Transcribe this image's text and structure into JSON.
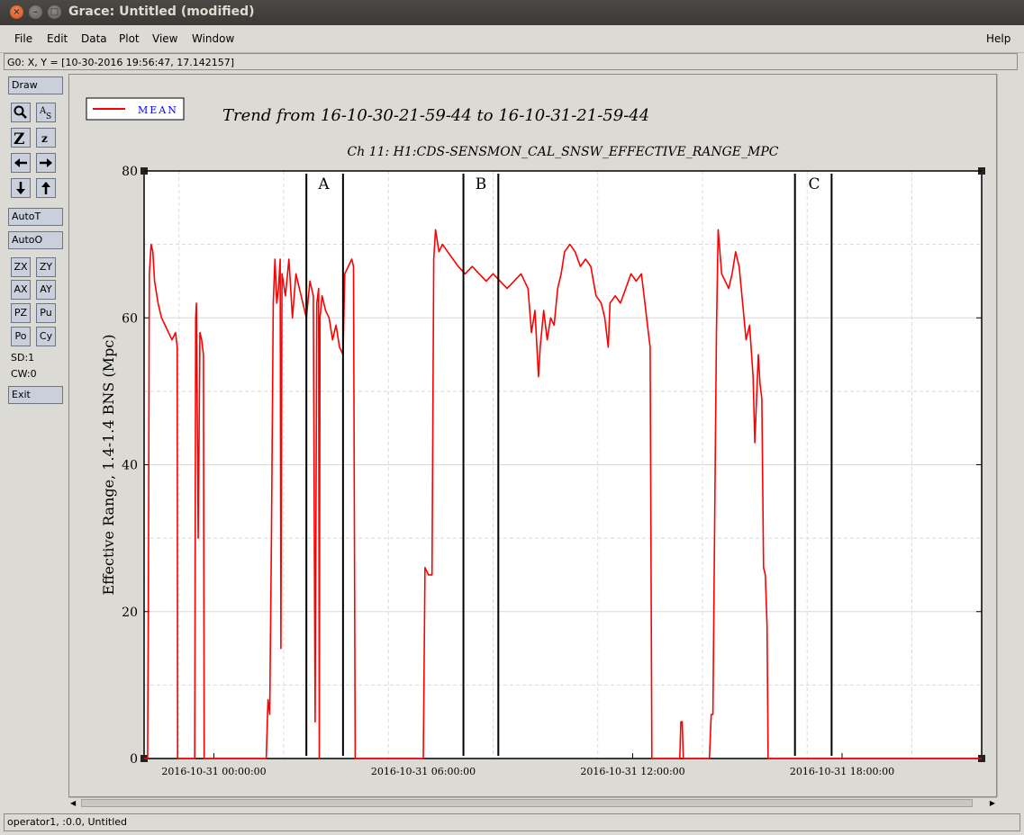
{
  "window": {
    "title": "Grace: Untitled (modified)"
  },
  "menu": {
    "file": "File",
    "edit": "Edit",
    "data": "Data",
    "plot": "Plot",
    "view": "View",
    "window": "Window",
    "help": "Help"
  },
  "locator": "G0: X, Y = [10-30-2016 19:56:47, 17.142157]",
  "toolbar": {
    "draw": "Draw",
    "autot": "AutoT",
    "autoo": "AutoO",
    "zx": "ZX",
    "zy": "ZY",
    "ax": "AX",
    "ay": "AY",
    "pz": "PZ",
    "pu": "Pu",
    "po": "Po",
    "cy": "Cy",
    "sd": "SD:1",
    "cw": "CW:0",
    "exit": "Exit"
  },
  "status": "operator1, :0.0, Untitled",
  "colors": {
    "series": "#ff0000",
    "markers": "#000000",
    "legend_text": "#0000ff"
  },
  "chart_data": {
    "type": "line",
    "title": "Trend from 16-10-30-21-59-44 to 16-10-31-21-59-44",
    "subtitle": "Ch 11: H1:CDS-SENSMON_CAL_SNSW_EFFECTIVE_RANGE_MPC",
    "ylabel": "Effective Range, 1.4-1.4 BNS (Mpc)",
    "xlabel": "",
    "xlim": [
      -2.0,
      22.0
    ],
    "ylim": [
      0,
      80
    ],
    "yticks": [
      0,
      20,
      40,
      60,
      80
    ],
    "xticks": [
      {
        "x": 0,
        "label": "2016-10-31 00:00:00"
      },
      {
        "x": 6,
        "label": "2016-10-31 06:00:00"
      },
      {
        "x": 12,
        "label": "2016-10-31 12:00:00"
      },
      {
        "x": 18,
        "label": "2016-10-31 18:00:00"
      }
    ],
    "x_units": "hours relative to 2016-10-31 00:00:00",
    "grid": true,
    "legend": {
      "position": "top-left",
      "entries": [
        "MEAN"
      ]
    },
    "series": [
      {
        "name": "MEAN",
        "points": [
          [
            -2.0,
            0
          ],
          [
            -1.9,
            0
          ],
          [
            -1.88,
            20
          ],
          [
            -1.85,
            66
          ],
          [
            -1.8,
            70
          ],
          [
            -1.75,
            69
          ],
          [
            -1.7,
            65
          ],
          [
            -1.6,
            62
          ],
          [
            -1.5,
            60
          ],
          [
            -1.4,
            59
          ],
          [
            -1.3,
            58
          ],
          [
            -1.2,
            57
          ],
          [
            -1.1,
            58
          ],
          [
            -1.05,
            56
          ],
          [
            -1.04,
            0
          ],
          [
            -0.55,
            0
          ],
          [
            -0.54,
            22
          ],
          [
            -0.52,
            60
          ],
          [
            -0.5,
            62
          ],
          [
            -0.45,
            30
          ],
          [
            -0.4,
            58
          ],
          [
            -0.35,
            57
          ],
          [
            -0.3,
            55
          ],
          [
            -0.28,
            0
          ],
          [
            1.5,
            0
          ],
          [
            1.55,
            8
          ],
          [
            1.6,
            6
          ],
          [
            1.65,
            30
          ],
          [
            1.7,
            62
          ],
          [
            1.75,
            68
          ],
          [
            1.8,
            62
          ],
          [
            1.85,
            64
          ],
          [
            1.9,
            68
          ],
          [
            1.92,
            15
          ],
          [
            1.95,
            66
          ],
          [
            2.05,
            63
          ],
          [
            2.15,
            68
          ],
          [
            2.25,
            60
          ],
          [
            2.35,
            66
          ],
          [
            2.45,
            64
          ],
          [
            2.55,
            62
          ],
          [
            2.65,
            60
          ],
          [
            2.75,
            65
          ],
          [
            2.85,
            63
          ],
          [
            2.9,
            5
          ],
          [
            2.95,
            62
          ],
          [
            3.0,
            64
          ],
          [
            3.02,
            0
          ],
          [
            3.04,
            60
          ],
          [
            3.1,
            63
          ],
          [
            3.2,
            61
          ],
          [
            3.3,
            60
          ],
          [
            3.4,
            57
          ],
          [
            3.5,
            59
          ],
          [
            3.6,
            56
          ],
          [
            3.7,
            55
          ],
          [
            3.75,
            66
          ],
          [
            3.85,
            67
          ],
          [
            3.95,
            68
          ],
          [
            4.0,
            67
          ],
          [
            4.05,
            0
          ],
          [
            6.0,
            0
          ],
          [
            6.05,
            26
          ],
          [
            6.15,
            25
          ],
          [
            6.25,
            25
          ],
          [
            6.3,
            68
          ],
          [
            6.35,
            72
          ],
          [
            6.45,
            69
          ],
          [
            6.55,
            70
          ],
          [
            6.7,
            69
          ],
          [
            6.85,
            68
          ],
          [
            7.0,
            67
          ],
          [
            7.2,
            66
          ],
          [
            7.4,
            67
          ],
          [
            7.6,
            66
          ],
          [
            7.8,
            65
          ],
          [
            8.0,
            66
          ],
          [
            8.2,
            65
          ],
          [
            8.4,
            64
          ],
          [
            8.6,
            65
          ],
          [
            8.8,
            66
          ],
          [
            9.0,
            64
          ],
          [
            9.1,
            58
          ],
          [
            9.2,
            61
          ],
          [
            9.3,
            52
          ],
          [
            9.35,
            56
          ],
          [
            9.45,
            61
          ],
          [
            9.55,
            57
          ],
          [
            9.65,
            60
          ],
          [
            9.75,
            59
          ],
          [
            9.85,
            64
          ],
          [
            9.95,
            66
          ],
          [
            10.05,
            69
          ],
          [
            10.2,
            70
          ],
          [
            10.35,
            69
          ],
          [
            10.5,
            67
          ],
          [
            10.65,
            68
          ],
          [
            10.8,
            67
          ],
          [
            10.95,
            63
          ],
          [
            11.1,
            62
          ],
          [
            11.2,
            60
          ],
          [
            11.3,
            56
          ],
          [
            11.35,
            62
          ],
          [
            11.5,
            63
          ],
          [
            11.65,
            62
          ],
          [
            11.8,
            64
          ],
          [
            11.95,
            66
          ],
          [
            12.1,
            65
          ],
          [
            12.25,
            66
          ],
          [
            12.35,
            62
          ],
          [
            12.45,
            58
          ],
          [
            12.5,
            56
          ],
          [
            12.55,
            0
          ],
          [
            13.35,
            0
          ],
          [
            13.38,
            5
          ],
          [
            13.42,
            5
          ],
          [
            13.45,
            0
          ],
          [
            14.2,
            0
          ],
          [
            14.25,
            6
          ],
          [
            14.3,
            6
          ],
          [
            14.35,
            33
          ],
          [
            14.4,
            58
          ],
          [
            14.45,
            72
          ],
          [
            14.55,
            66
          ],
          [
            14.65,
            65
          ],
          [
            14.75,
            64
          ],
          [
            14.85,
            66
          ],
          [
            14.95,
            69
          ],
          [
            15.05,
            67
          ],
          [
            15.15,
            62
          ],
          [
            15.25,
            57
          ],
          [
            15.35,
            59
          ],
          [
            15.45,
            52
          ],
          [
            15.5,
            43
          ],
          [
            15.6,
            55
          ],
          [
            15.65,
            51
          ],
          [
            15.7,
            49
          ],
          [
            15.75,
            26
          ],
          [
            15.8,
            25
          ],
          [
            15.85,
            18
          ],
          [
            15.88,
            0
          ],
          [
            22.0,
            0
          ]
        ]
      }
    ],
    "markers": [
      {
        "x": 2.65,
        "label": ""
      },
      {
        "x": 3.7,
        "label": ""
      },
      {
        "x": 3.15,
        "label": "A"
      },
      {
        "x": 7.15,
        "label": ""
      },
      {
        "x": 8.15,
        "label": ""
      },
      {
        "x": 7.65,
        "label": "B"
      },
      {
        "x": 16.65,
        "label": ""
      },
      {
        "x": 17.7,
        "label": ""
      },
      {
        "x": 17.2,
        "label": "C"
      }
    ]
  }
}
